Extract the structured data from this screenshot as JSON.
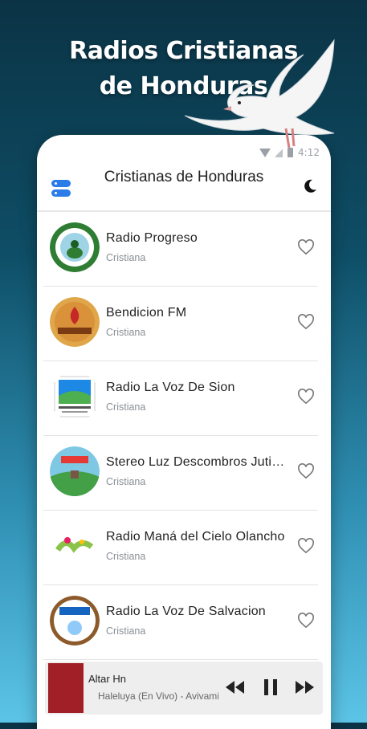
{
  "promo": {
    "line1": "Radios Cristianas",
    "line2": "de Honduras"
  },
  "status": {
    "time": "4:12"
  },
  "appbar": {
    "title": "Cristianas de Honduras"
  },
  "stations": [
    {
      "name": "Radio Progreso",
      "genre": "Cristiana"
    },
    {
      "name": "Bendicion FM",
      "genre": "Cristiana"
    },
    {
      "name": "Radio La Voz De Sion",
      "genre": "Cristiana"
    },
    {
      "name": "Stereo Luz Descombros Jutiapa",
      "genre": "Cristiana"
    },
    {
      "name": "Radio Maná del Cielo Olancho",
      "genre": "Cristiana"
    },
    {
      "name": "Radio La Voz De Salvacion",
      "genre": "Cristiana"
    }
  ],
  "player": {
    "station": "Altar Hn",
    "song": "Haleluya (En Vivo) - Avivamiento"
  },
  "icons": {
    "menu": "menu-toggle-icon",
    "theme": "moon-icon",
    "favorite": "heart-outline-icon",
    "prev": "rewind-icon",
    "pause": "pause-icon",
    "next": "fast-forward-icon"
  },
  "colors": {
    "accent": "#2b7be8",
    "background_top": "#0b3345",
    "background_bottom": "#5cc4e6",
    "cover": "#a11f27"
  }
}
